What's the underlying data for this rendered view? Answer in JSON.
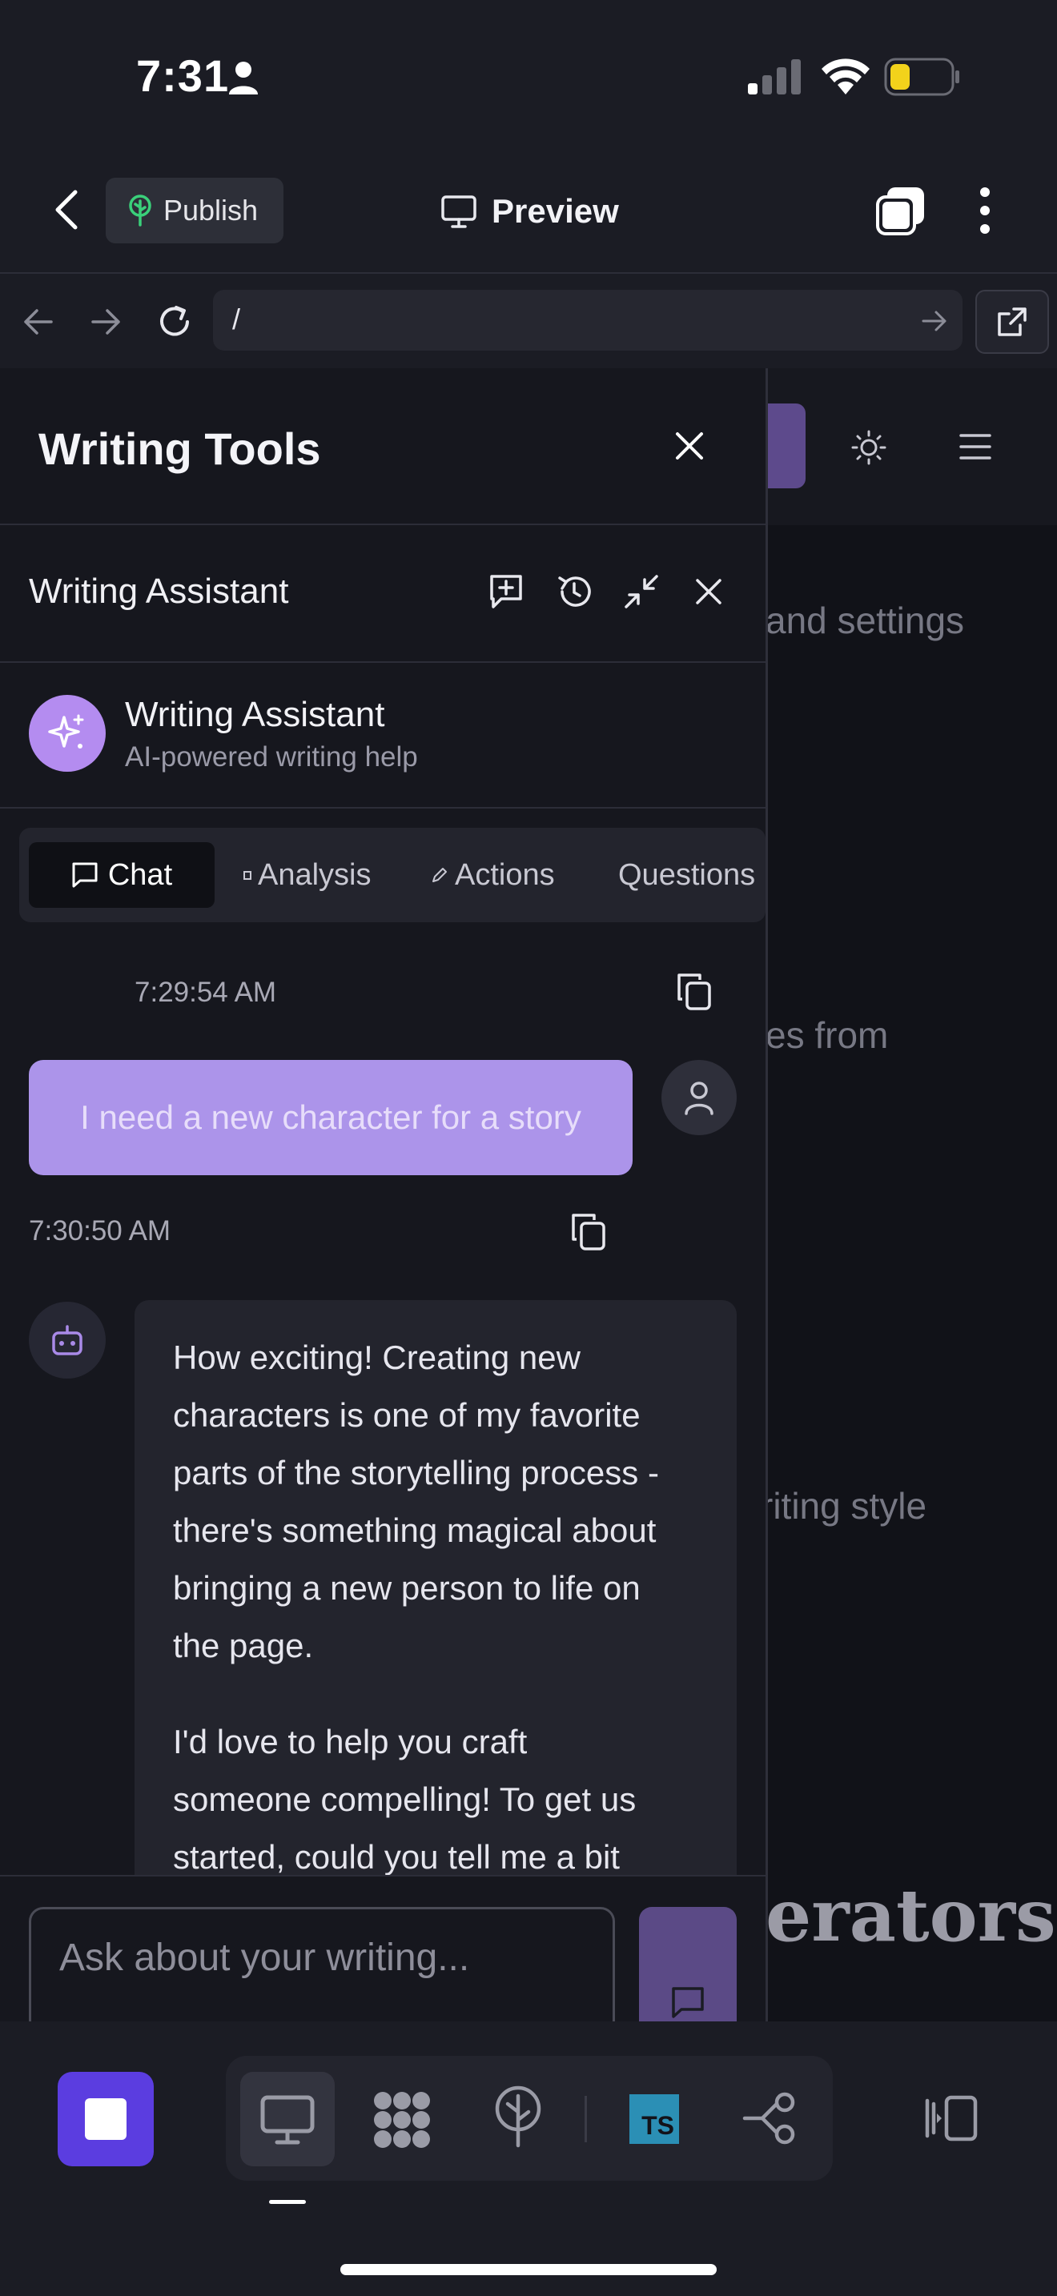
{
  "status_bar": {
    "time": "7:31"
  },
  "top_nav": {
    "publish_label": "Publish",
    "preview_label": "Preview"
  },
  "url_bar": {
    "path": "/"
  },
  "background_page": {
    "snippets": [
      "and settings",
      "es from",
      "riting style"
    ],
    "heading": "erators"
  },
  "panel": {
    "title": "Writing Tools",
    "assistant_header": "Writing Assistant",
    "assistant_card": {
      "name": "Writing Assistant",
      "subtitle": "AI-powered writing help"
    },
    "tabs": [
      {
        "label": "Chat",
        "active": true
      },
      {
        "label": "Analysis",
        "active": false
      },
      {
        "label": "Actions",
        "active": false
      },
      {
        "label": "Questions",
        "active": false
      }
    ]
  },
  "messages": [
    {
      "role": "user",
      "time": "7:29:54 AM",
      "text": "I need a new character for a story"
    },
    {
      "role": "assistant",
      "time": "7:30:50 AM",
      "paragraphs": [
        [
          "How exciting! Creating new",
          "characters is one of my favorite",
          "parts of the storytelling process -",
          "there's something magical about",
          "bringing a new person to life on",
          "the page."
        ],
        [
          "I'd love to help you craft",
          "someone compelling! To get us",
          "started, could you tell me a bit"
        ]
      ]
    }
  ],
  "chat_input": {
    "placeholder": "Ask about your writing..."
  },
  "bottom_toolbar": {
    "ts_label": "TS"
  },
  "colors": {
    "accent": "#5b3de0",
    "user_bubble": "#ac94ea",
    "avatar": "#b48cf0",
    "ts_blue": "#2b8fb5"
  }
}
